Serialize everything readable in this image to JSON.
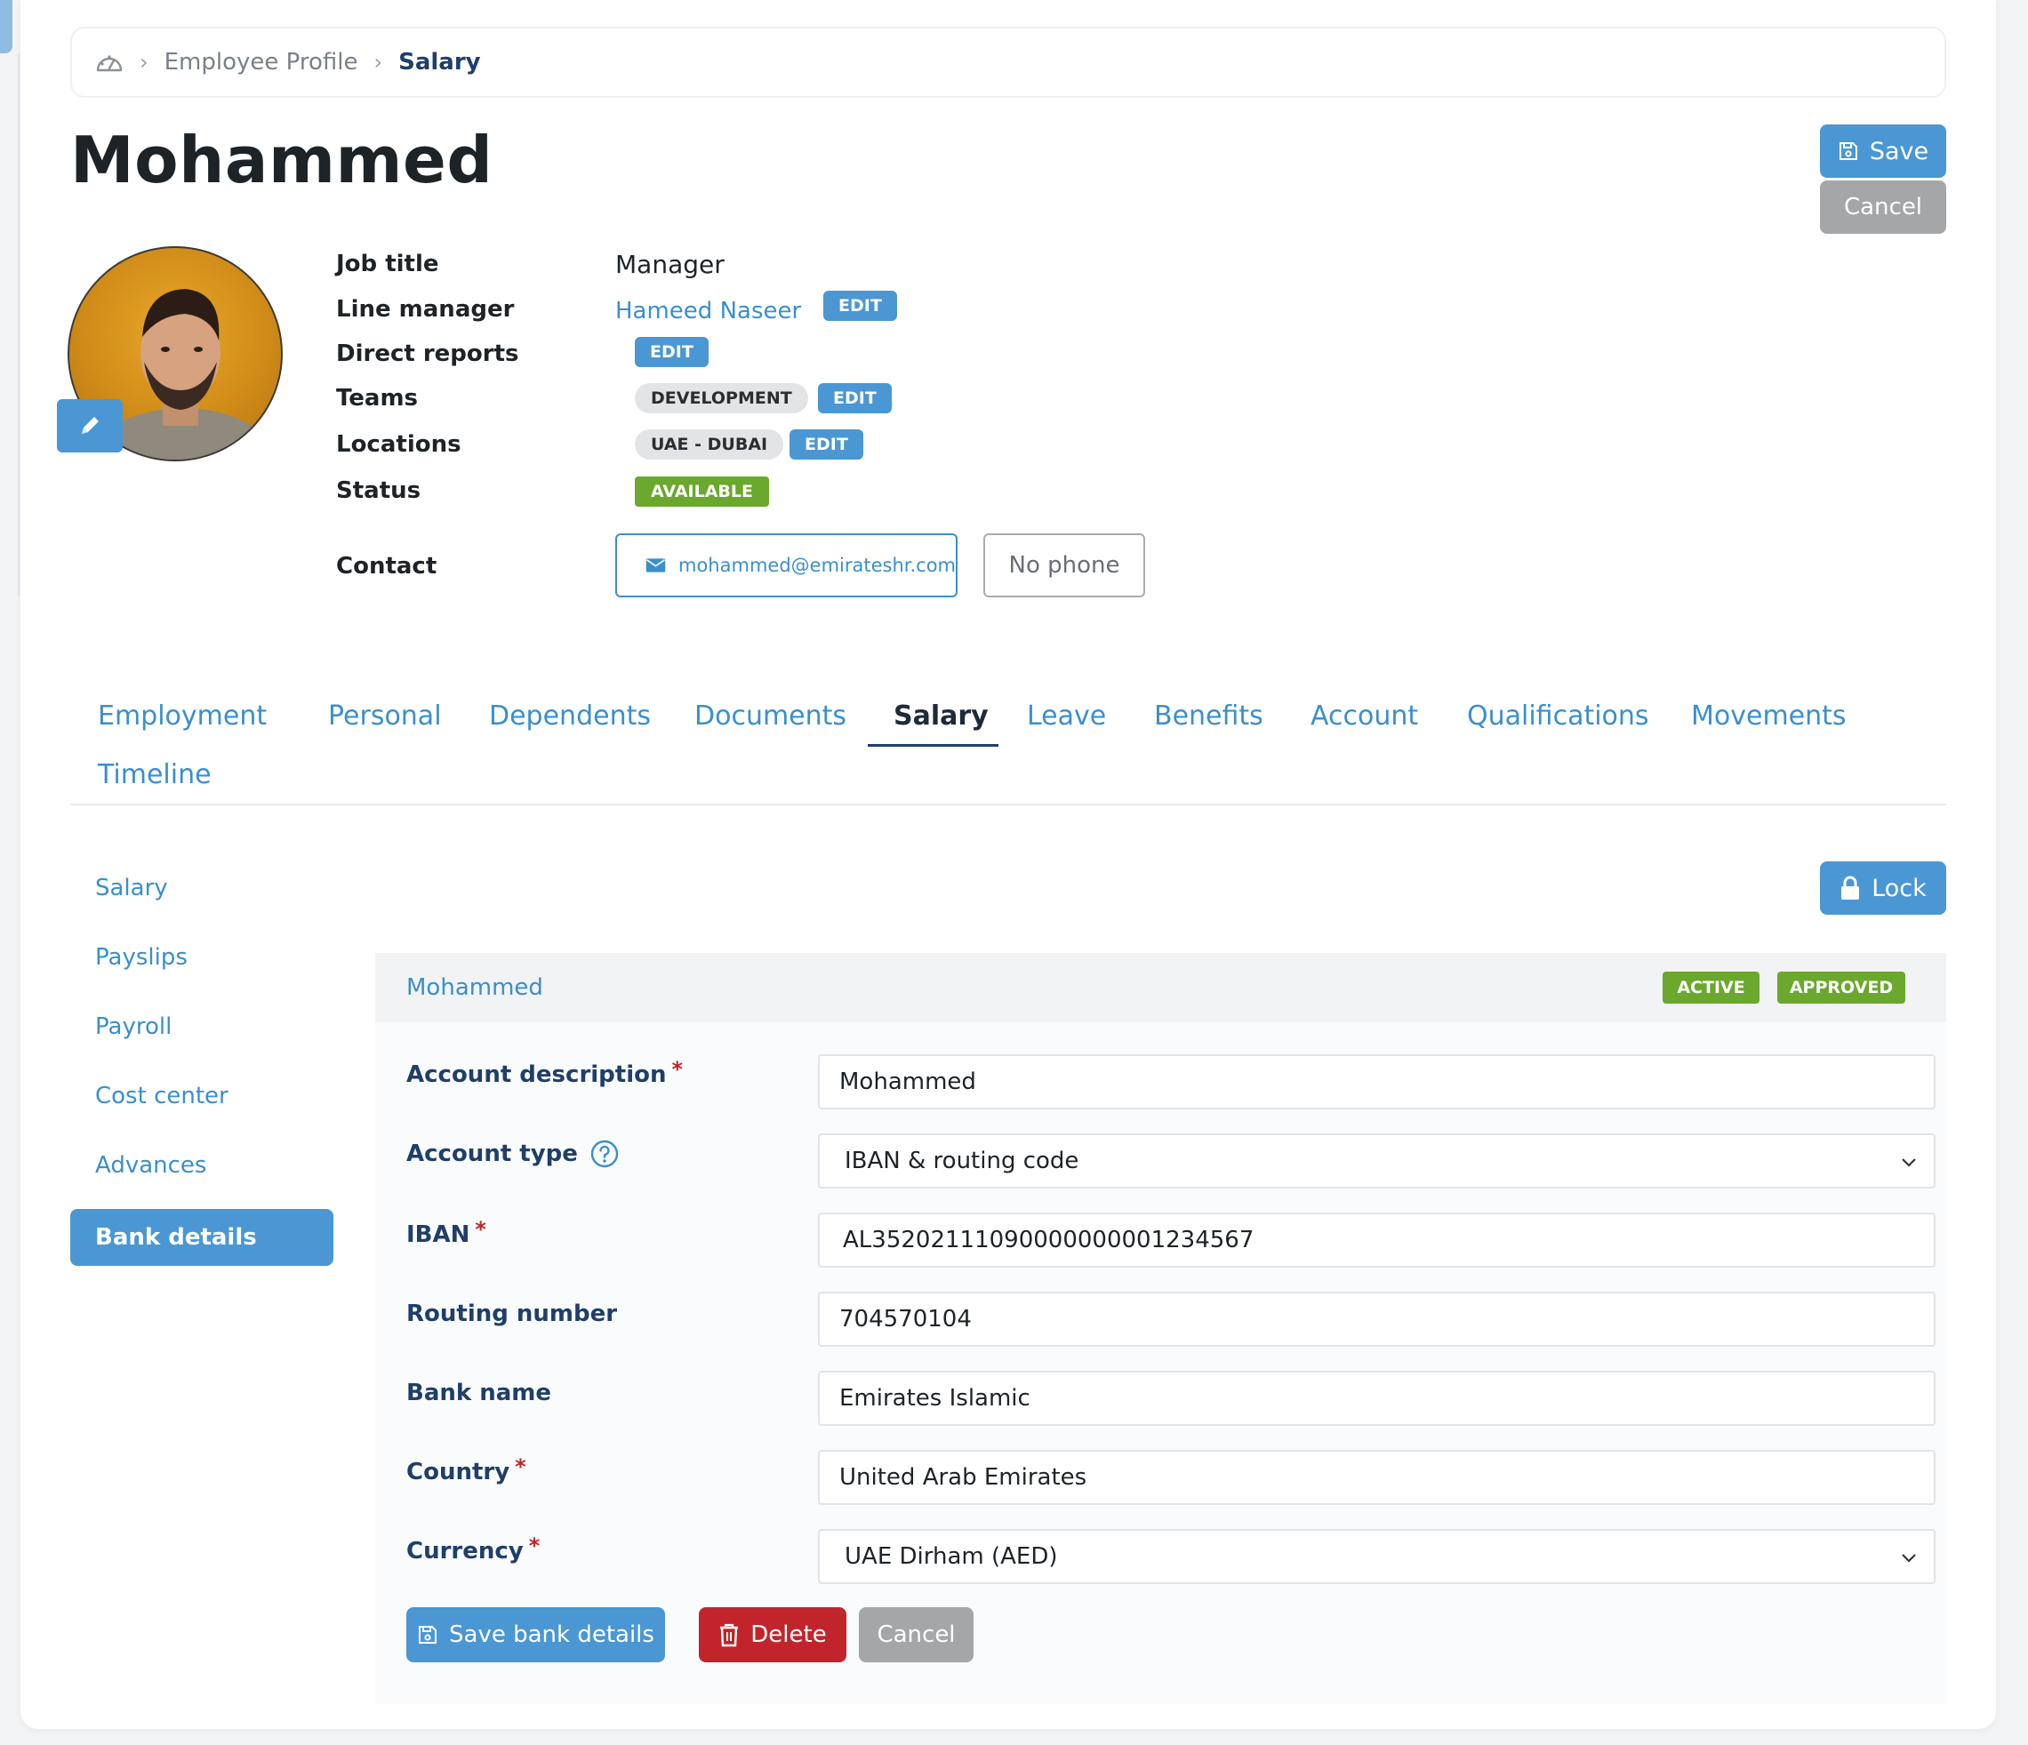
{
  "breadcrumb": {
    "home_icon": "dashboard-gauge-icon",
    "items": [
      "Employee Profile",
      "Salary"
    ]
  },
  "page": {
    "title": "Mohammed"
  },
  "header_actions": {
    "save": "Save",
    "cancel": "Cancel"
  },
  "profile": {
    "job_title_label": "Job title",
    "job_title": "Manager",
    "line_manager_label": "Line manager",
    "line_manager": "Hameed Naseer",
    "direct_reports_label": "Direct reports",
    "teams_label": "Teams",
    "team": "DEVELOPMENT",
    "locations_label": "Locations",
    "location": "UAE - DUBAI",
    "status_label": "Status",
    "status": "AVAILABLE",
    "contact_label": "Contact",
    "email": "mohammed@emirateshr.com",
    "phone": "No phone",
    "edit_label": "EDIT"
  },
  "tabs": [
    "Employment",
    "Personal",
    "Dependents",
    "Documents",
    "Salary",
    "Leave",
    "Benefits",
    "Account",
    "Qualifications",
    "Movements",
    "Timeline"
  ],
  "active_tab": "Salary",
  "submenu": [
    "Salary",
    "Payslips",
    "Payroll",
    "Cost center",
    "Advances",
    "Bank details"
  ],
  "active_submenu": "Bank details",
  "lock_label": "Lock",
  "bank_panel": {
    "title": "Mohammed",
    "badges": [
      "ACTIVE",
      "APPROVED"
    ],
    "fields": {
      "account_description": {
        "label": "Account description",
        "value": "Mohammed"
      },
      "account_type": {
        "label": "Account type",
        "value": "IBAN & routing code"
      },
      "iban": {
        "label": "IBAN",
        "value": "AL35202111090000000001234567"
      },
      "routing_number": {
        "label": "Routing number",
        "value": "704570104"
      },
      "bank_name": {
        "label": "Bank name",
        "value": "Emirates Islamic"
      },
      "country": {
        "label": "Country",
        "value": "United Arab Emirates"
      },
      "currency": {
        "label": "Currency",
        "value": "UAE Dirham (AED)"
      }
    },
    "required_mark": "*",
    "actions": {
      "save": "Save bank details",
      "delete": "Delete",
      "cancel": "Cancel"
    }
  },
  "colors": {
    "primary": "#4a97d4",
    "link": "#3a8fce",
    "success": "#6aa82e",
    "danger": "#c1252b",
    "neutral": "#a4a6a8",
    "heading": "#1f3f6a"
  }
}
